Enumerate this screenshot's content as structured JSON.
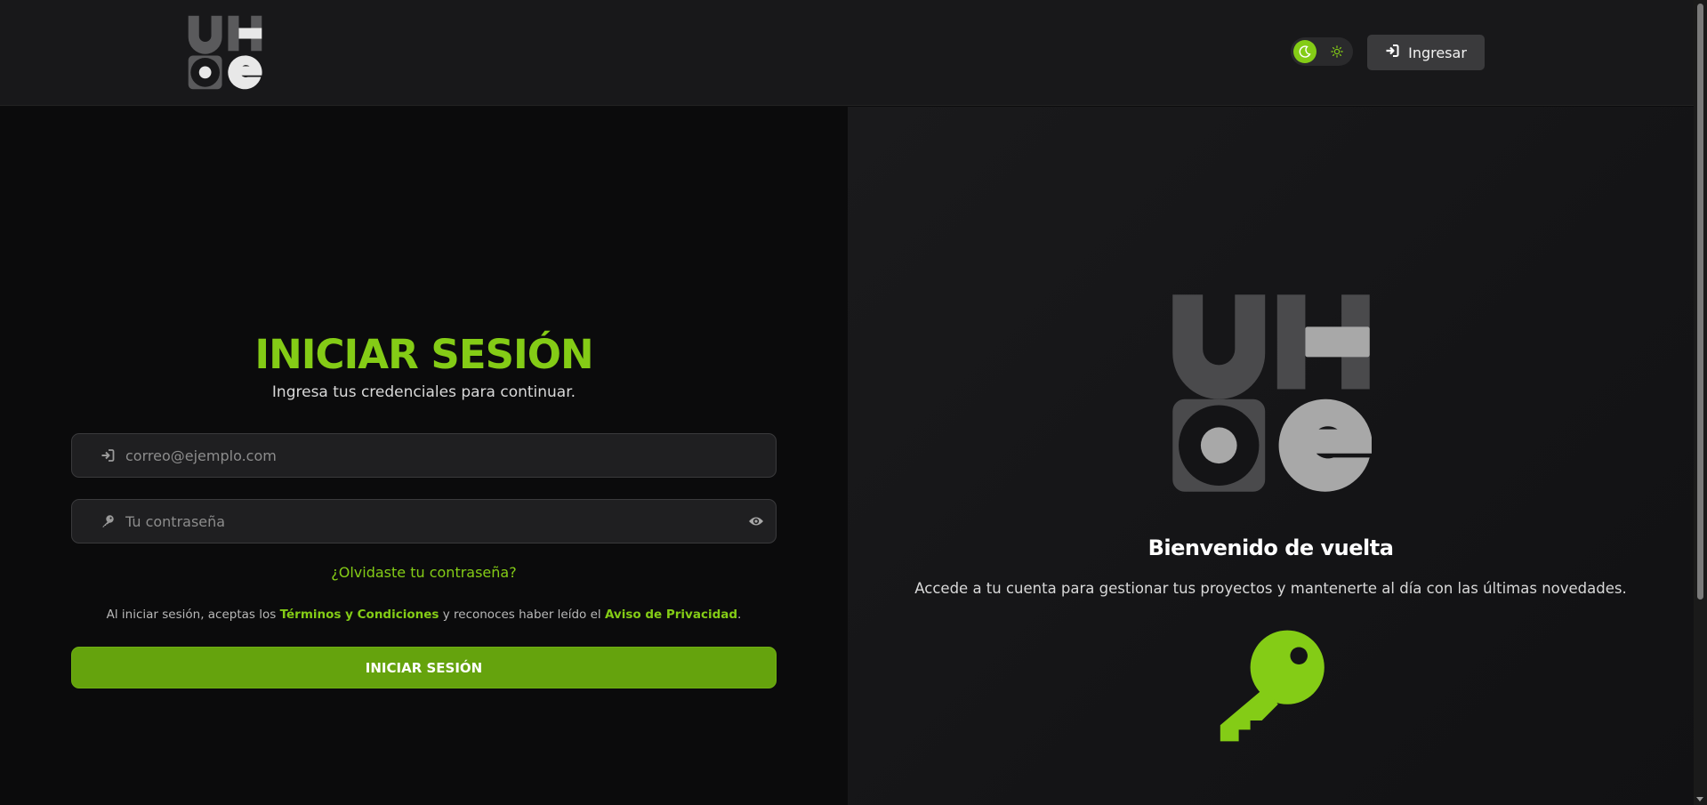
{
  "header": {
    "logo_alt": "UHOE",
    "theme_toggle": {
      "active": "dark",
      "dark_icon": "moon-icon",
      "light_icon": "sun-icon"
    },
    "login_button": {
      "label": "Ingresar",
      "icon": "sign-in-icon"
    }
  },
  "login": {
    "title": "INICIAR SESIÓN",
    "subtitle": "Ingresa tus credenciales para continuar.",
    "email": {
      "placeholder": "correo@ejemplo.com",
      "value": "",
      "icon": "sign-in-icon"
    },
    "password": {
      "placeholder": "Tu contraseña",
      "value": "",
      "icon": "key-icon",
      "toggle_icon": "eye-icon"
    },
    "forgot_link": "¿Olvidaste tu contraseña?",
    "terms": {
      "prefix": "Al iniciar sesión, aceptas los ",
      "terms_link": "Términos y Condiciones",
      "middle": " y reconoces haber leído el ",
      "privacy_link": "Aviso de Privacidad",
      "suffix": "."
    },
    "submit_label": "INICIAR SESIÓN"
  },
  "welcome": {
    "title": "Bienvenido de vuelta",
    "text": "Accede a tu cuenta para gestionar tus proyectos y mantenerte al día con las últimas novedades.",
    "icon": "key-icon"
  },
  "colors": {
    "accent": "#84cc16",
    "button": "#65a30d",
    "header_bg": "#18181a",
    "left_bg": "#0b0b0c",
    "right_bg": "#161618"
  }
}
